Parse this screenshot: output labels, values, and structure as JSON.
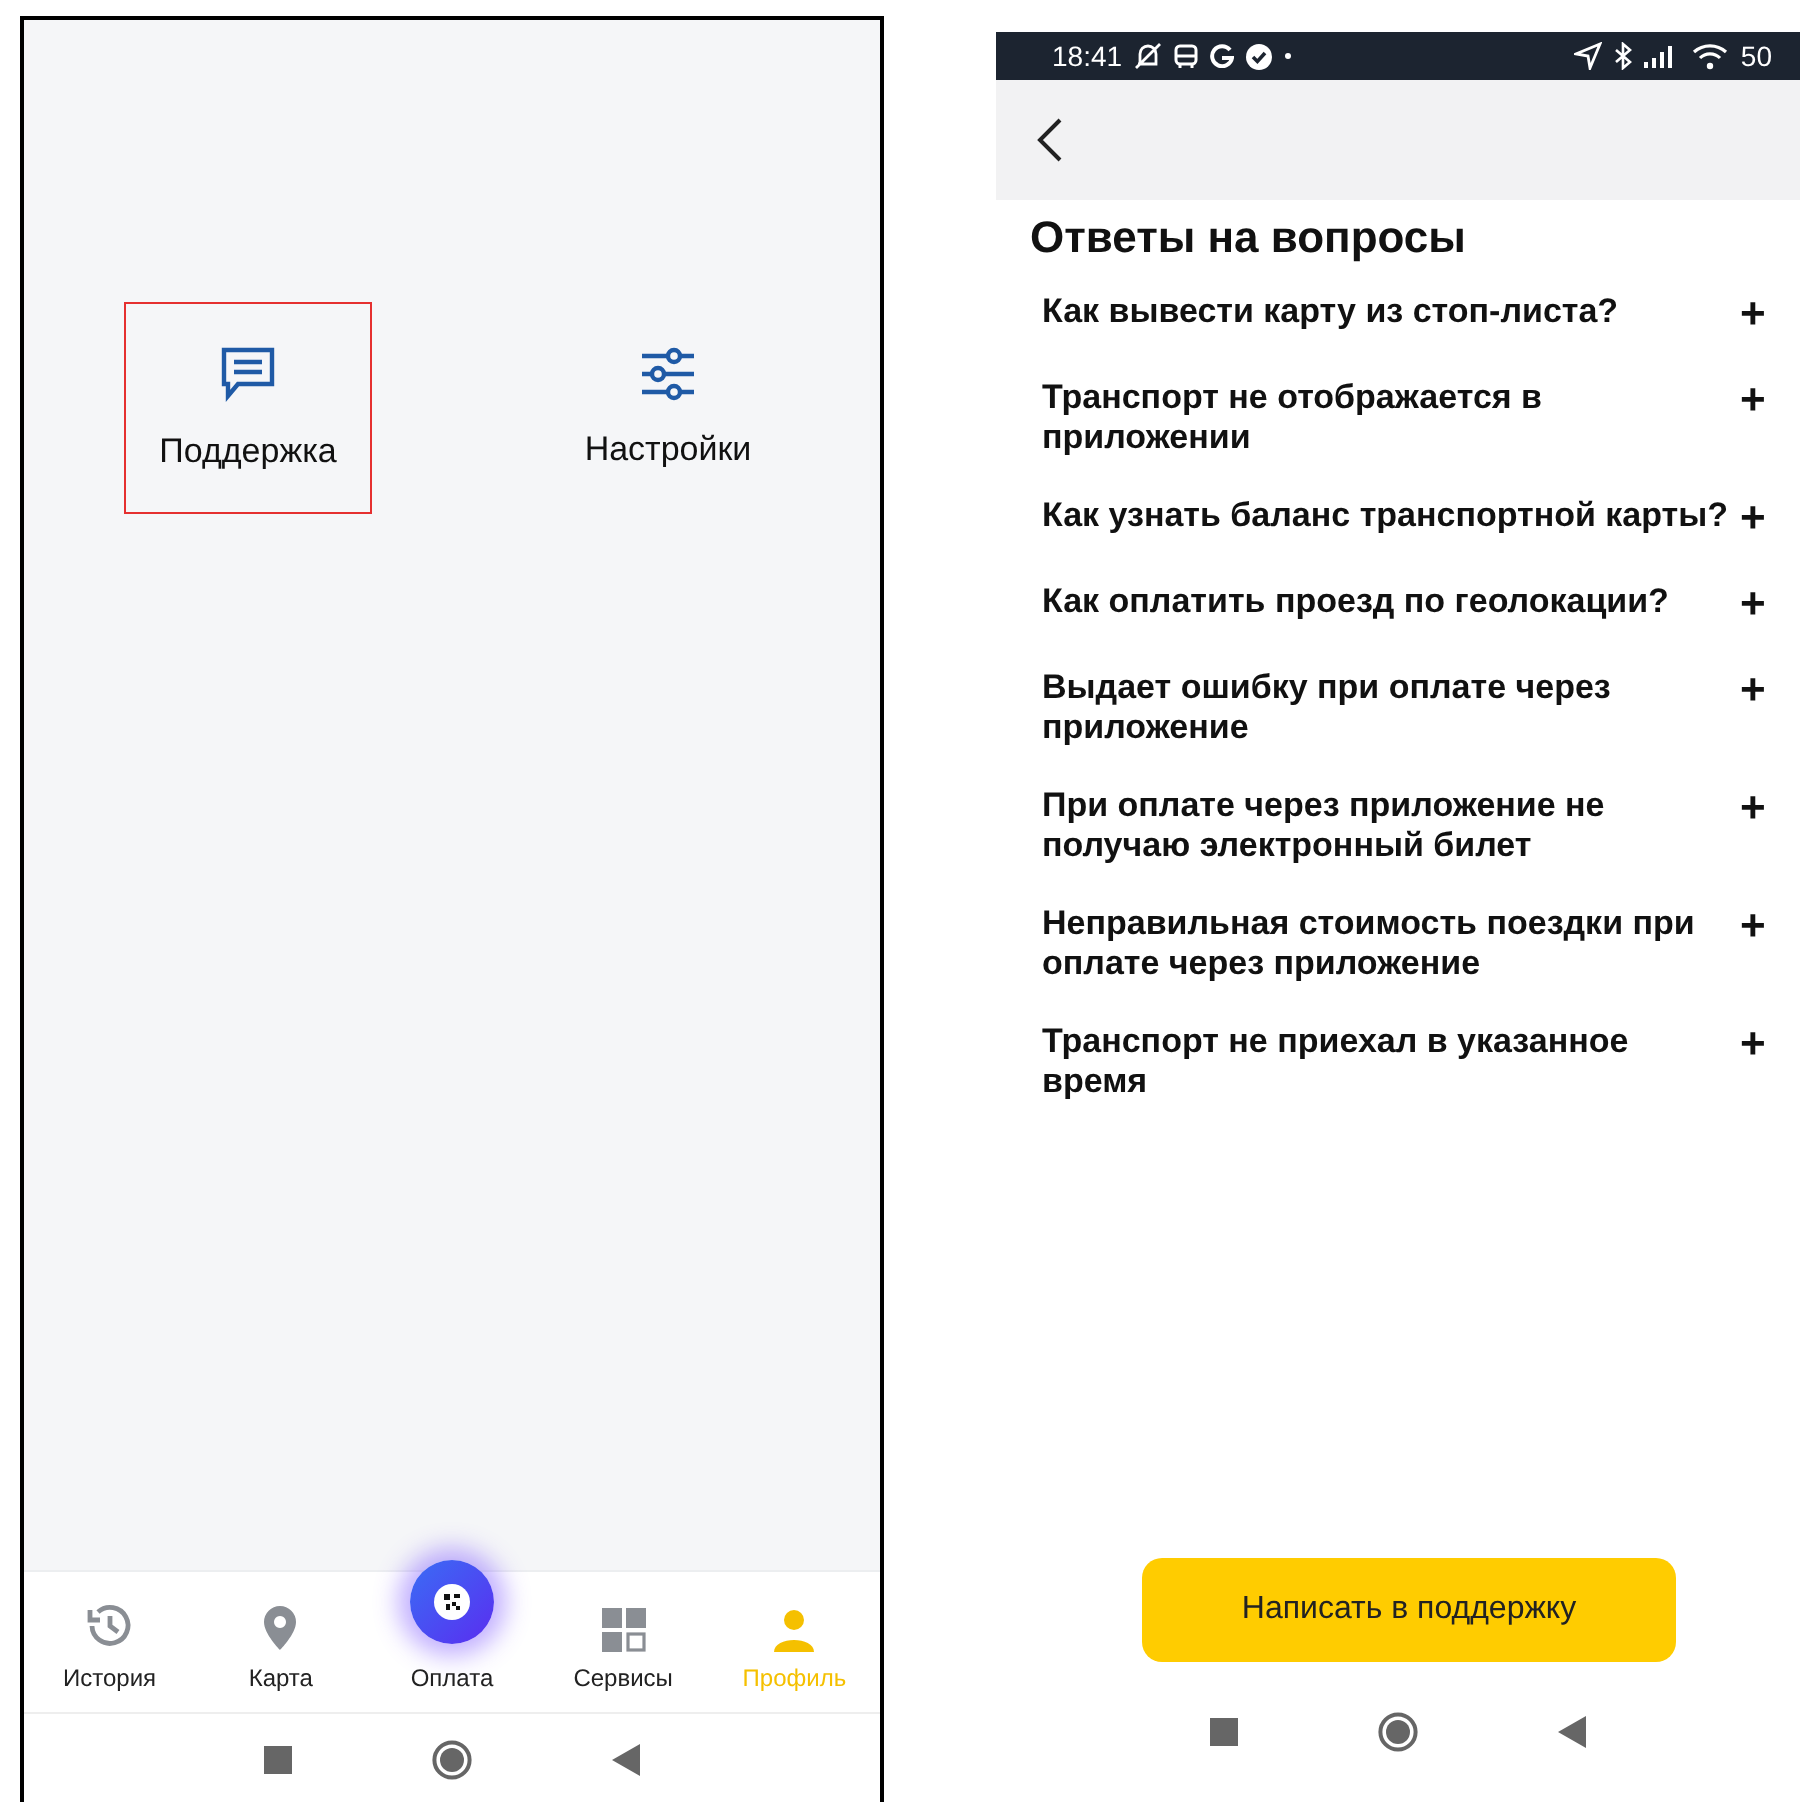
{
  "left_screen": {
    "menu_items": [
      {
        "kind": "support",
        "label": "Поддержка",
        "highlighted": true
      },
      {
        "kind": "settings",
        "label": "Настройки",
        "highlighted": false
      }
    ],
    "bottom_nav": [
      {
        "kind": "history",
        "label": "История",
        "selected": false
      },
      {
        "kind": "map",
        "label": "Карта",
        "selected": false
      },
      {
        "kind": "pay",
        "label": "Оплата",
        "selected": false
      },
      {
        "kind": "services",
        "label": "Сервисы",
        "selected": false
      },
      {
        "kind": "profile",
        "label": "Профиль",
        "selected": true
      }
    ]
  },
  "right_screen": {
    "status_bar": {
      "time": "18:41",
      "battery": "50"
    },
    "title": "Ответы на вопросы",
    "faq": [
      {
        "question": "Как вывести карту из стоп-листа?",
        "toggle": "+"
      },
      {
        "question": "Транспорт не отображается в приложении",
        "toggle": "+"
      },
      {
        "question": "Как узнать баланс транспортной карты?",
        "toggle": "+"
      },
      {
        "question": "Как оплатить проезд по геолокации?",
        "toggle": "+"
      },
      {
        "question": "Выдает ошибку при оплате через приложение",
        "toggle": "+"
      },
      {
        "question": "При оплате через приложение не получаю электронный билет",
        "toggle": "+"
      },
      {
        "question": "Неправильная стоимость поездки при оплате через приложение",
        "toggle": "+"
      },
      {
        "question": "Транспорт не приехал в указанное время",
        "toggle": "+"
      }
    ],
    "support_button": "Написать в поддержку"
  }
}
